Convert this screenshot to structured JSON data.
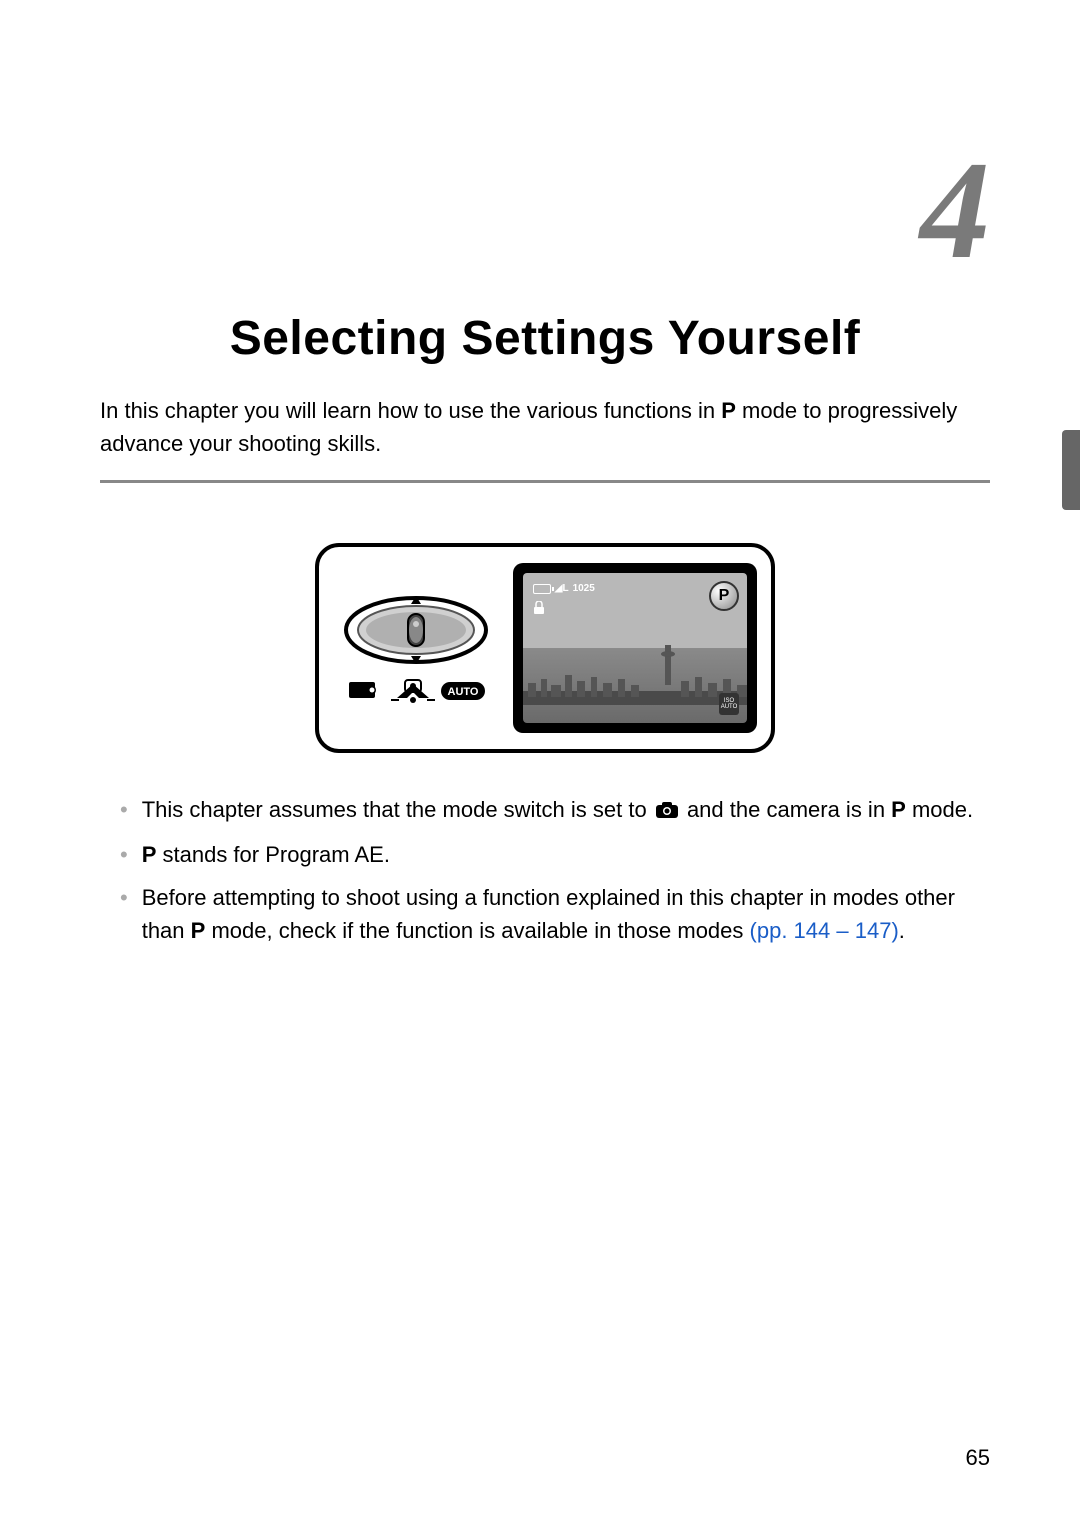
{
  "chapter_number": "4",
  "chapter_title": "Selecting Settings Yourself",
  "intro_part1": "In this chapter you will learn how to use the various functions in ",
  "intro_part2": " mode to progressively advance your shooting skills.",
  "p_symbol": "P",
  "figure": {
    "auto_label": "AUTO",
    "p_badge": "P",
    "iso_top": "ISO",
    "iso_bottom": "AUTO",
    "shots_label": "1025"
  },
  "bullets": [
    {
      "part1": "This chapter assumes that the mode switch is set to ",
      "part2": " and the camera is in ",
      "part3": " mode."
    },
    {
      "part1": "",
      "part2": " stands for Program AE."
    },
    {
      "part1": "Before attempting to shoot using a function explained in this chapter in modes other than ",
      "part2": " mode, check if the function is available in those modes ",
      "link1": "(pp. 144",
      "dash": " – ",
      "link2": "147)",
      "part3": "."
    }
  ],
  "page_number": "65",
  "icons": {
    "camera": "camera-icon",
    "p": "p-mode-icon"
  }
}
